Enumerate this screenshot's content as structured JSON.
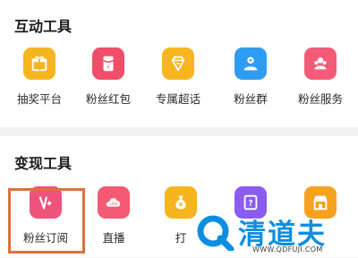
{
  "sections": [
    {
      "title": "互动工具",
      "tools": [
        {
          "label": "抽奖平台",
          "icon": "gift-icon",
          "color": "#f6b51f"
        },
        {
          "label": "粉丝红包",
          "icon": "red-envelope-icon",
          "color": "#f24e69"
        },
        {
          "label": "专属超话",
          "icon": "diamond-icon",
          "color": "#f7b520"
        },
        {
          "label": "粉丝群",
          "icon": "group-icon",
          "color": "#2f9cf4"
        },
        {
          "label": "粉丝服务",
          "icon": "service-icon",
          "color": "#f45b78"
        }
      ]
    },
    {
      "title": "变现工具",
      "tools": [
        {
          "label": "粉丝订阅",
          "icon": "subscribe-v-icon",
          "color": "#f0527e"
        },
        {
          "label": "直播",
          "icon": "live-cloud-icon",
          "color": "#f45a72"
        },
        {
          "label": "打",
          "icon": "money-bag-icon",
          "color": "#f6b51f"
        },
        {
          "label": "",
          "icon": "question-icon",
          "color": "#8a5cf0"
        },
        {
          "label": "",
          "icon": "shop-icon",
          "color": "#f6a21f"
        }
      ]
    }
  ],
  "highlight_color": "#e0703b",
  "watermark": {
    "text": "清道夫",
    "url": "WWW.QDFUJI.COM",
    "color": "#0c8fe0"
  }
}
